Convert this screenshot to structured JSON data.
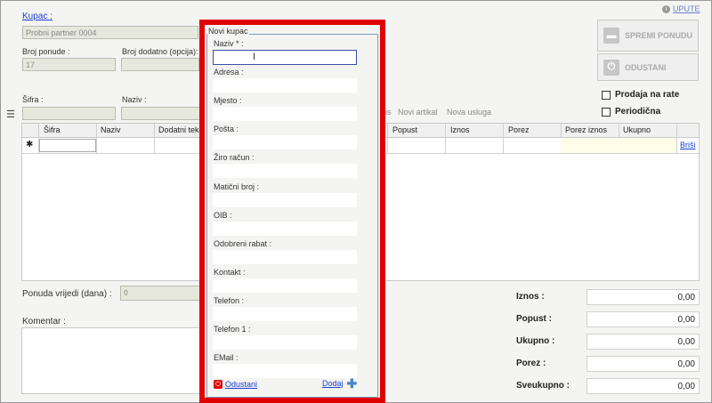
{
  "header": {
    "kupac_label": "Kupac :",
    "kupac_value": "Probni partner 0004",
    "upute_link": "UPUTE"
  },
  "offer": {
    "broj_ponude_label": "Broj ponude :",
    "broj_ponude_value": "17",
    "broj_dodatno_label": "Broj dodatno (opcija):"
  },
  "buttons": {
    "spremi_label": "SPREMI PONUDU",
    "odustani_label": "ODUSTANI"
  },
  "options": {
    "prodaja_na_rate": "Prodaja na rate",
    "periodicna": "Periodična"
  },
  "article_filter": {
    "sifra_label": "Šifra :",
    "naziv_label": "Naziv :",
    "partial_label": "is",
    "novi_artikal": "Novi artikal",
    "nova_usluga": "Nova usluga"
  },
  "grid": {
    "columns": [
      "Šifra",
      "Naziv",
      "Dodatni teks",
      "Popust",
      "Iznos",
      "Porez",
      "Porez iznos",
      "Ukupno"
    ],
    "row_marker": "✱",
    "delete_link": "Briši"
  },
  "footer": {
    "ponuda_vrijedi_label": "Ponuda vrijedi (dana) :",
    "ponuda_vrijedi_value": "0",
    "komentar_label": "Komentar :"
  },
  "totals": [
    {
      "label": "Iznos :",
      "value": "0,00"
    },
    {
      "label": "Popust :",
      "value": "0,00"
    },
    {
      "label": "Ukupno :",
      "value": "0,00"
    },
    {
      "label": "Porez :",
      "value": "0,00"
    },
    {
      "label": "Sveukupno :",
      "value": "0,00"
    }
  ],
  "modal": {
    "title": "Novi kupac",
    "fields": [
      {
        "label": "Naziv * :"
      },
      {
        "label": "Adresa :"
      },
      {
        "label": "Mjesto :"
      },
      {
        "label": "Pošta :"
      },
      {
        "label": "Žiro račun :"
      },
      {
        "label": "Matični broj :"
      },
      {
        "label": "OIB :"
      },
      {
        "label": "Odobreni rabat  :"
      },
      {
        "label": "Kontakt :"
      },
      {
        "label": "Telefon :"
      },
      {
        "label": "Telefon 1 :"
      },
      {
        "label": "EMail :"
      }
    ],
    "odustani_link": "Odustani",
    "dodaj_link": "Dodaj"
  },
  "colors": {
    "highlight": "#e00000",
    "link": "#1a3fd0"
  }
}
